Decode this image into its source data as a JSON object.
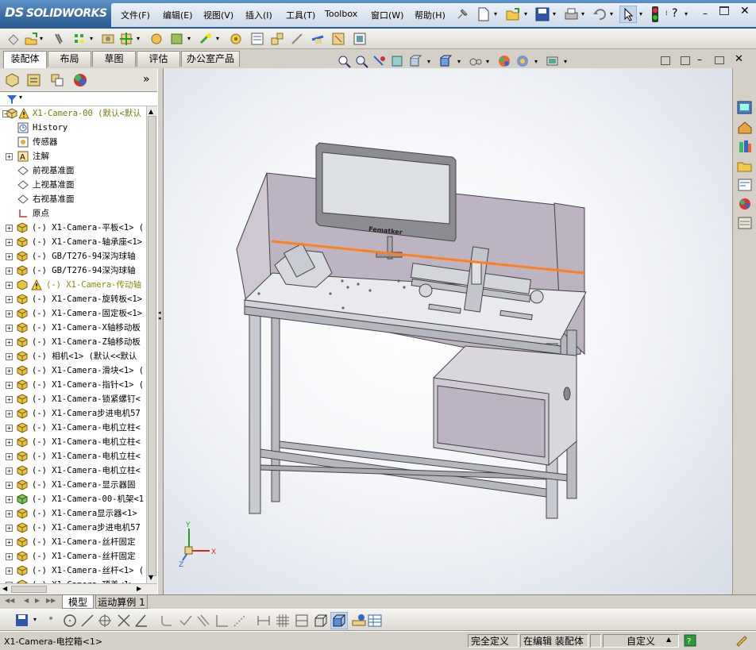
{
  "app": {
    "logo_prefix": "DS",
    "logo": "SOLIDWORKS"
  },
  "menu": [
    "文件(F)",
    "编辑(E)",
    "视图(V)",
    "插入(I)",
    "工具(T)",
    "Toolbox",
    "窗口(W)",
    "帮助(H)"
  ],
  "command_tabs": [
    "装配体",
    "布局",
    "草图",
    "评估",
    "办公室产品"
  ],
  "feature_tree": {
    "root": "X1-Camera-00  (默认<默认",
    "items": [
      {
        "label": "History",
        "icon": "history-icon",
        "expand": false
      },
      {
        "label": "传感器",
        "icon": "sensor-icon",
        "expand": false
      },
      {
        "label": "注解",
        "icon": "annotation-icon",
        "expand": true
      },
      {
        "label": "前视基准面",
        "icon": "plane-icon",
        "expand": false
      },
      {
        "label": "上视基准面",
        "icon": "plane-icon",
        "expand": false
      },
      {
        "label": "右视基准面",
        "icon": "plane-icon",
        "expand": false
      },
      {
        "label": "原点",
        "icon": "origin-icon",
        "expand": false
      },
      {
        "label": "(-) X1-Camera-平板<1>  (",
        "icon": "part-icon",
        "expand": true
      },
      {
        "label": "(-) X1-Camera-轴承座<1>",
        "icon": "part-icon",
        "expand": true
      },
      {
        "label": "(-) GB/T276-94深沟球轴",
        "icon": "part-icon",
        "expand": true
      },
      {
        "label": "(-) GB/T276-94深沟球轴",
        "icon": "part-icon",
        "expand": true
      },
      {
        "label": "(-) X1-Camera-传动轴",
        "icon": "part-warning-icon",
        "expand": true,
        "warn": true
      },
      {
        "label": "(-) X1-Camera-旋转板<1>",
        "icon": "part-icon",
        "expand": true
      },
      {
        "label": "(-) X1-Camera-固定板<1>",
        "icon": "part-icon",
        "expand": true
      },
      {
        "label": "(-) X1-Camera-X轴移动板",
        "icon": "part-icon",
        "expand": true
      },
      {
        "label": "(-) X1-Camera-Z轴移动板",
        "icon": "part-icon",
        "expand": true
      },
      {
        "label": "(-) 相机<1> (默认<<默认",
        "icon": "part-icon",
        "expand": true
      },
      {
        "label": "(-) X1-Camera-滑块<1>  (",
        "icon": "part-icon",
        "expand": true
      },
      {
        "label": "(-) X1-Camera-指针<1>  (",
        "icon": "part-icon",
        "expand": true
      },
      {
        "label": "(-) X1-Camera-锁紧螺钉<",
        "icon": "part-icon",
        "expand": true
      },
      {
        "label": "(-) X1-Camera步进电机57",
        "icon": "part-icon",
        "expand": true
      },
      {
        "label": "(-) X1-Camera-电机立柱<",
        "icon": "part-icon",
        "expand": true
      },
      {
        "label": "(-) X1-Camera-电机立柱<",
        "icon": "part-icon",
        "expand": true
      },
      {
        "label": "(-) X1-Camera-电机立柱<",
        "icon": "part-icon",
        "expand": true
      },
      {
        "label": "(-) X1-Camera-电机立柱<",
        "icon": "part-icon",
        "expand": true
      },
      {
        "label": "(-) X1-Camera-显示器固",
        "icon": "part-icon",
        "expand": true
      },
      {
        "label": "(-) X1-Camera-00-机架<1",
        "icon": "subassembly-icon",
        "expand": true
      },
      {
        "label": "(-) X1-Camera显示器<1>",
        "icon": "part-icon",
        "expand": true
      },
      {
        "label": "(-) X1-Camera步进电机57",
        "icon": "part-icon",
        "expand": true
      },
      {
        "label": "(-) X1-Camera-丝杆固定",
        "icon": "part-icon",
        "expand": true
      },
      {
        "label": "(-) X1-Camera-丝杆固定",
        "icon": "part-icon",
        "expand": true
      },
      {
        "label": "(-) X1-Camera-丝杆<1>  (",
        "icon": "part-icon",
        "expand": true
      },
      {
        "label": "(-) X1-Camera-顶盖<1>",
        "icon": "part-icon",
        "expand": true
      }
    ]
  },
  "model_tabs": [
    "模型",
    "运动算例 1"
  ],
  "monitor_brand": "Fematker",
  "triad": {
    "x": "X",
    "y": "Y",
    "z": "Z"
  },
  "status": {
    "selection": "X1-Camera-电控箱<1>",
    "definition": "完全定义",
    "mode": "在编辑 装配体",
    "units": "自定义"
  },
  "colors": {
    "accent": "#3a6ea5",
    "highlight_edge": "#ff7f1e",
    "part_yellow": "#e8c020"
  }
}
